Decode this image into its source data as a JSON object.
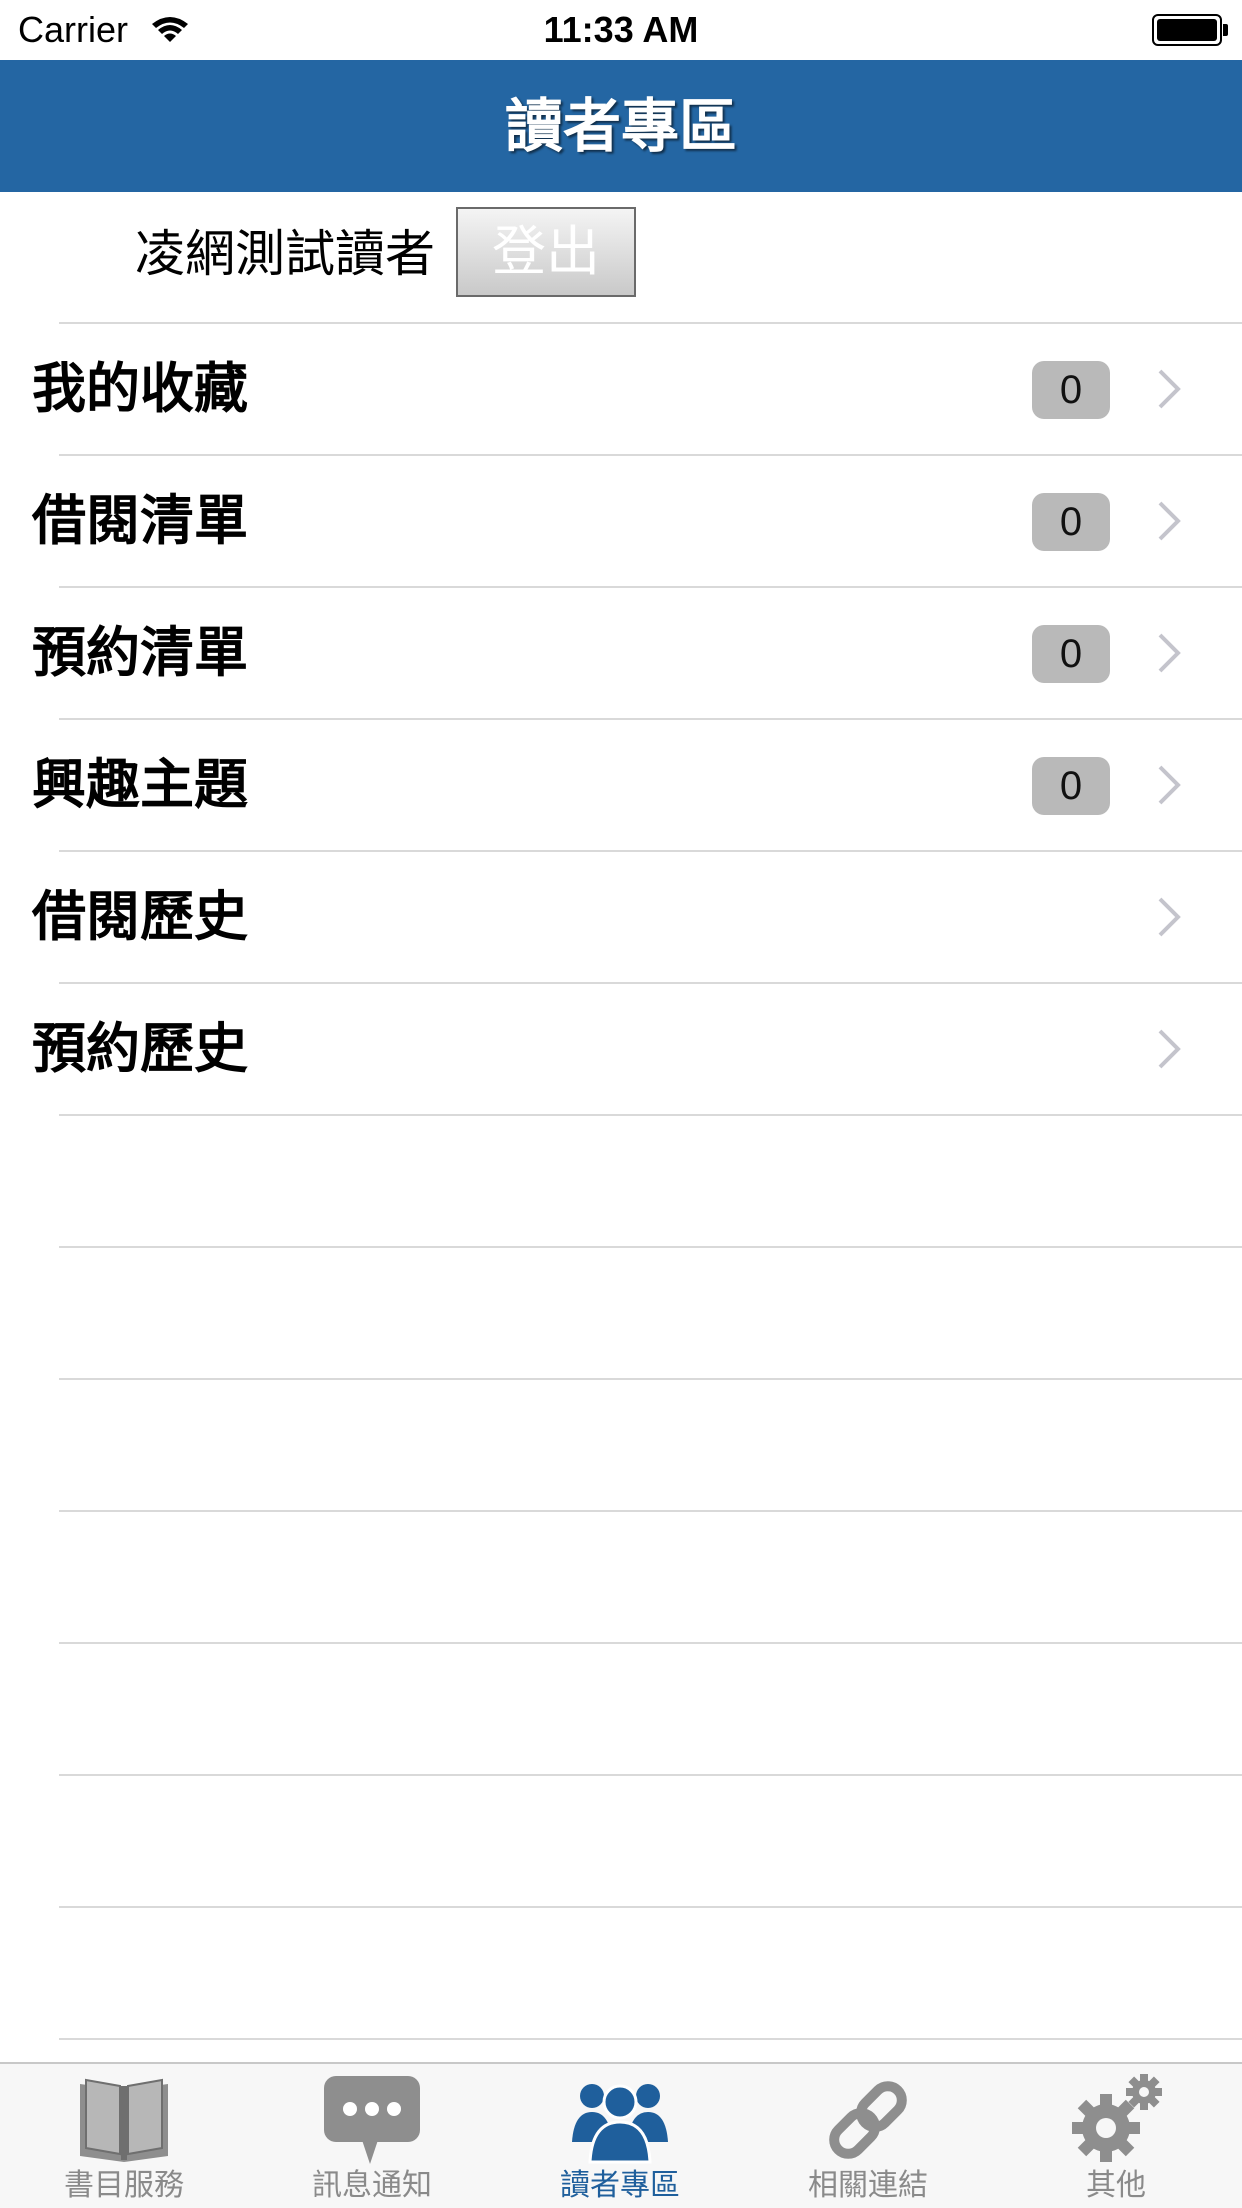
{
  "status_bar": {
    "carrier": "Carrier",
    "time": "11:33 AM",
    "wifi_icon": "wifi-icon",
    "battery_icon": "battery-icon"
  },
  "nav": {
    "title": "讀者專區",
    "color": "#2466a3"
  },
  "user": {
    "name": "凌網測試讀者",
    "logout_label": "登出"
  },
  "menu": [
    {
      "label": "我的收藏",
      "count": "0"
    },
    {
      "label": "借閱清單",
      "count": "0"
    },
    {
      "label": "預約清單",
      "count": "0"
    },
    {
      "label": "興趣主題",
      "count": "0"
    },
    {
      "label": "借閱歷史"
    },
    {
      "label": "預約歷史"
    }
  ],
  "tabs": [
    {
      "label": "書目服務",
      "icon": "book-icon"
    },
    {
      "label": "訊息通知",
      "icon": "chat-bubble-icon"
    },
    {
      "label": "讀者專區",
      "icon": "people-icon",
      "active": true
    },
    {
      "label": "相關連結",
      "icon": "link-icon"
    },
    {
      "label": "其他",
      "icon": "gear-icon"
    }
  ],
  "colors": {
    "tab_active": "#1f5f9c",
    "tab_inactive": "#8a8a8a",
    "badge": "#b9b9b9"
  }
}
